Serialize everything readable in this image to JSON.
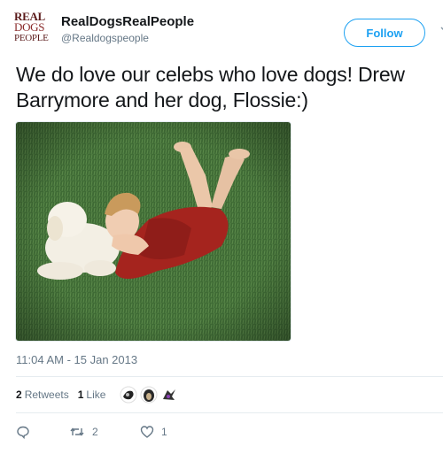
{
  "account": {
    "avatar_lines": [
      "REAL",
      "DOGS",
      "PEOPLE"
    ],
    "display_name": "RealDogsRealPeople",
    "handle": "@Realdogspeople"
  },
  "follow_label": "Follow",
  "tweet": {
    "line1": "We do love our celebs who love dogs!  Drew",
    "line2": "Barrymore and her dog, Flossie:)"
  },
  "timestamp": "11:04 AM - 15 Jan 2013",
  "stats": {
    "retweets_count": "2",
    "retweets_label": "Retweets",
    "likes_count": "1",
    "likes_label": "Like"
  },
  "actions": {
    "reply_count": "",
    "retweet_count": "2",
    "like_count": "1"
  },
  "colors": {
    "accent": "#1da1f2",
    "muted": "#657786",
    "text": "#14171a"
  }
}
